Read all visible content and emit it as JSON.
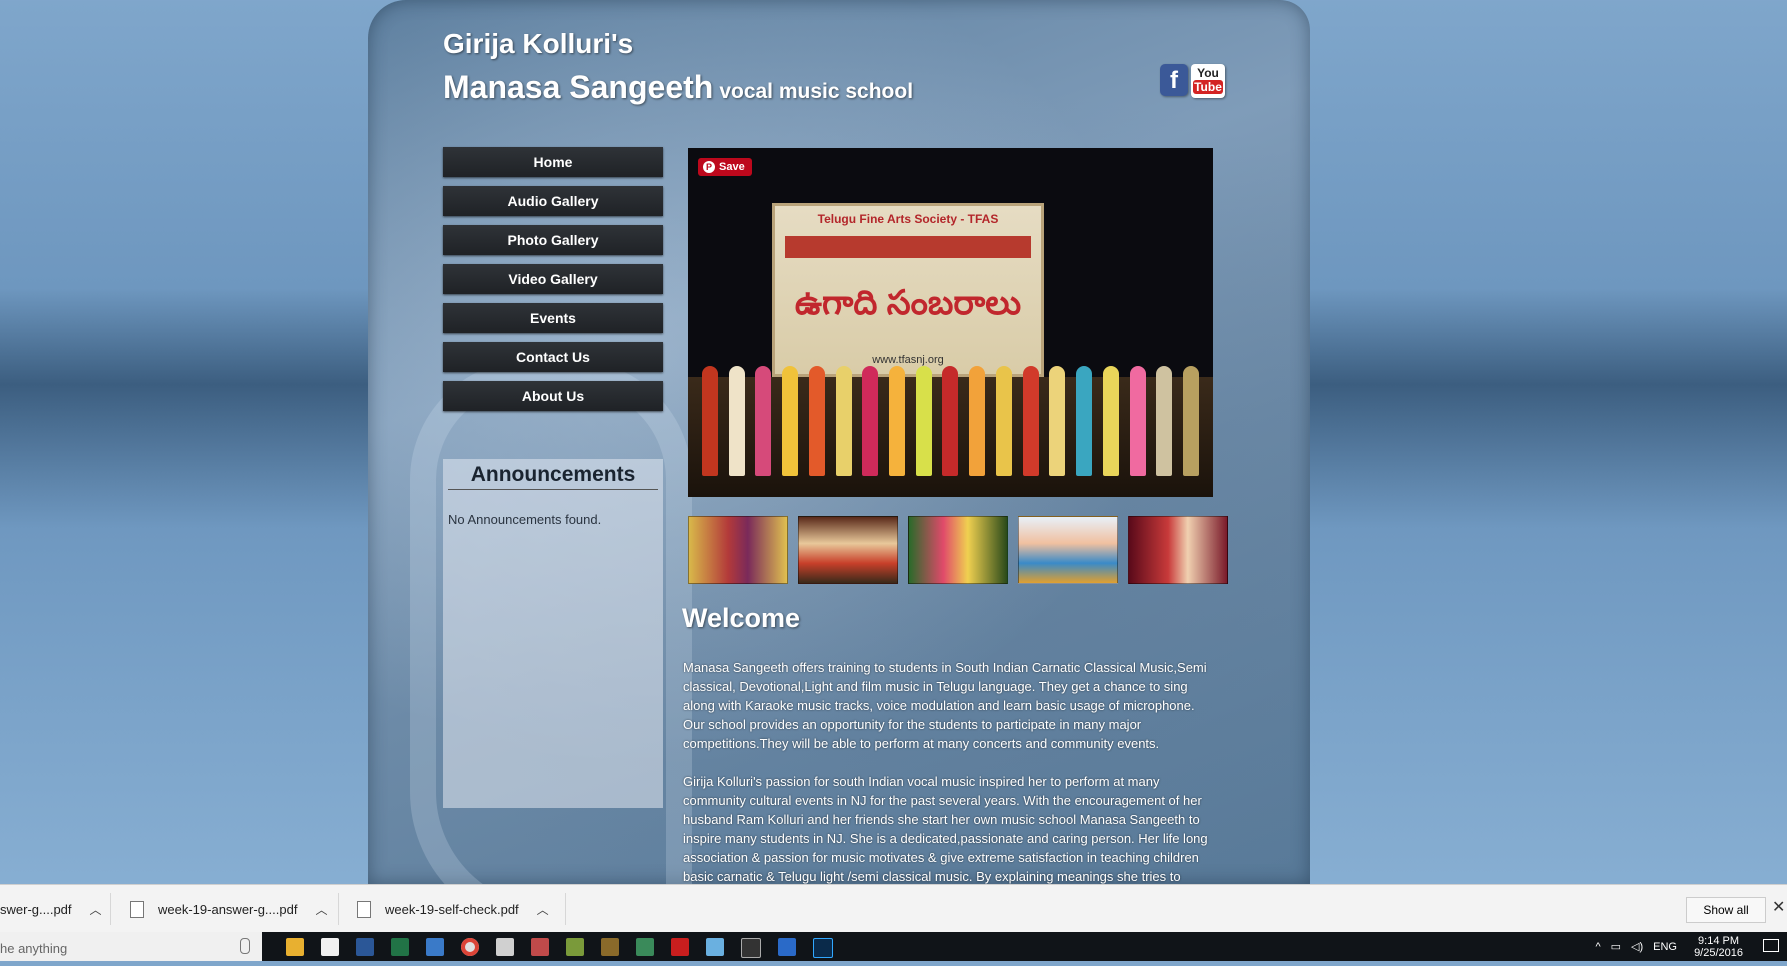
{
  "site": {
    "title_line1": "Girija Kolluri's",
    "title_line2": "Manasa Sangeeth",
    "tagline": "vocal music school",
    "social": {
      "facebook": "f",
      "youtube_top": "You",
      "youtube_bottom": "Tube"
    }
  },
  "nav": {
    "items": [
      {
        "label": "Home"
      },
      {
        "label": "Audio Gallery"
      },
      {
        "label": "Photo Gallery"
      },
      {
        "label": "Video Gallery"
      },
      {
        "label": "Events"
      },
      {
        "label": "Contact Us"
      },
      {
        "label": "About Us"
      }
    ]
  },
  "announcements": {
    "heading": "Announcements",
    "empty_text": "No Announcements found."
  },
  "hero": {
    "save_label": "Save",
    "banner_top": "Telugu Fine Arts Society - TFAS",
    "banner_main": "ఉగాది సంబరాలు",
    "banner_url": "www.tfasnj.org"
  },
  "welcome": {
    "heading": "Welcome",
    "paragraphs": [
      "Manasa Sangeeth offers training to students in South Indian Carnatic Classical Music,Semi classical, Devotional,Light and film music in Telugu language. They get a chance to sing along with Karaoke music tracks, voice modulation and learn basic usage of microphone. Our school provides an opportunity for the students to participate in many major competitions.They will be able to perform at many concerts and community events.",
      "Girija Kolluri's passion for south Indian vocal music inspired her to perform at many community cultural events in NJ for the past several years. With the encouragement of her husband Ram Kolluri and her friends she start her own music school Manasa Sangeeth to inspire many students in NJ. She is a dedicated,passionate and caring person. Her life long association & passion for music motivates & give extreme satisfaction in teaching children basic carnatic & Telugu light /semi classical music. By explaining meanings she tries to"
    ]
  },
  "downloads": {
    "items": [
      {
        "name": "swer-g....pdf"
      },
      {
        "name": "week-19-answer-g....pdf"
      },
      {
        "name": "week-19-self-check.pdf"
      }
    ],
    "show_all": "Show all"
  },
  "taskbar": {
    "search_placeholder": "he anything",
    "language": "ENG",
    "time": "9:14 PM",
    "date": "9/25/2016"
  }
}
